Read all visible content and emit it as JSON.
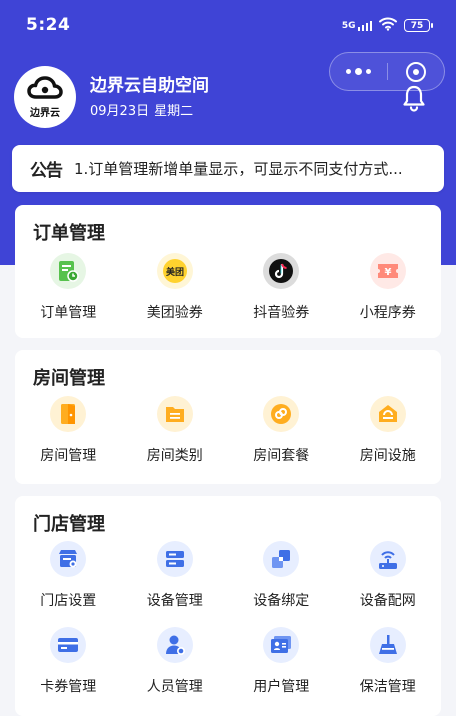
{
  "status_bar": {
    "time": "5:24",
    "network": "5G",
    "battery": "75"
  },
  "store": {
    "logo_text": "边界云",
    "name": "边界云自助空间",
    "date": "09月23日",
    "weekday": "星期二"
  },
  "notice": {
    "tag": "公告",
    "text": "1.订单管理新增单量显示，可显示不同支付方式..."
  },
  "sections": [
    {
      "title": "订单管理",
      "items": [
        {
          "label": "订单管理",
          "icon": "order-icon"
        },
        {
          "label": "美团验券",
          "icon": "meituan-icon",
          "icon_text": "美团"
        },
        {
          "label": "抖音验券",
          "icon": "douyin-icon"
        },
        {
          "label": "小程序券",
          "icon": "miniprogram-coupon-icon"
        }
      ]
    },
    {
      "title": "房间管理",
      "items": [
        {
          "label": "房间管理",
          "icon": "room-door-icon"
        },
        {
          "label": "房间类别",
          "icon": "room-category-icon"
        },
        {
          "label": "房间套餐",
          "icon": "room-package-icon"
        },
        {
          "label": "房间设施",
          "icon": "room-facility-icon"
        }
      ]
    },
    {
      "title": "门店管理",
      "items": [
        {
          "label": "门店设置",
          "icon": "store-settings-icon"
        },
        {
          "label": "设备管理",
          "icon": "device-management-icon"
        },
        {
          "label": "设备绑定",
          "icon": "device-binding-icon"
        },
        {
          "label": "设备配网",
          "icon": "device-network-icon"
        },
        {
          "label": "卡券管理",
          "icon": "coupon-card-icon"
        },
        {
          "label": "人员管理",
          "icon": "staff-icon"
        },
        {
          "label": "用户管理",
          "icon": "user-management-icon"
        },
        {
          "label": "保洁管理",
          "icon": "cleaning-icon"
        }
      ]
    }
  ],
  "colors": {
    "header_bg": "#3f44d6",
    "order_green": "#57c24d",
    "room_orange": "#ffad1f",
    "store_blue": "#3f6fe6",
    "page_bg": "#f4f5f9"
  }
}
